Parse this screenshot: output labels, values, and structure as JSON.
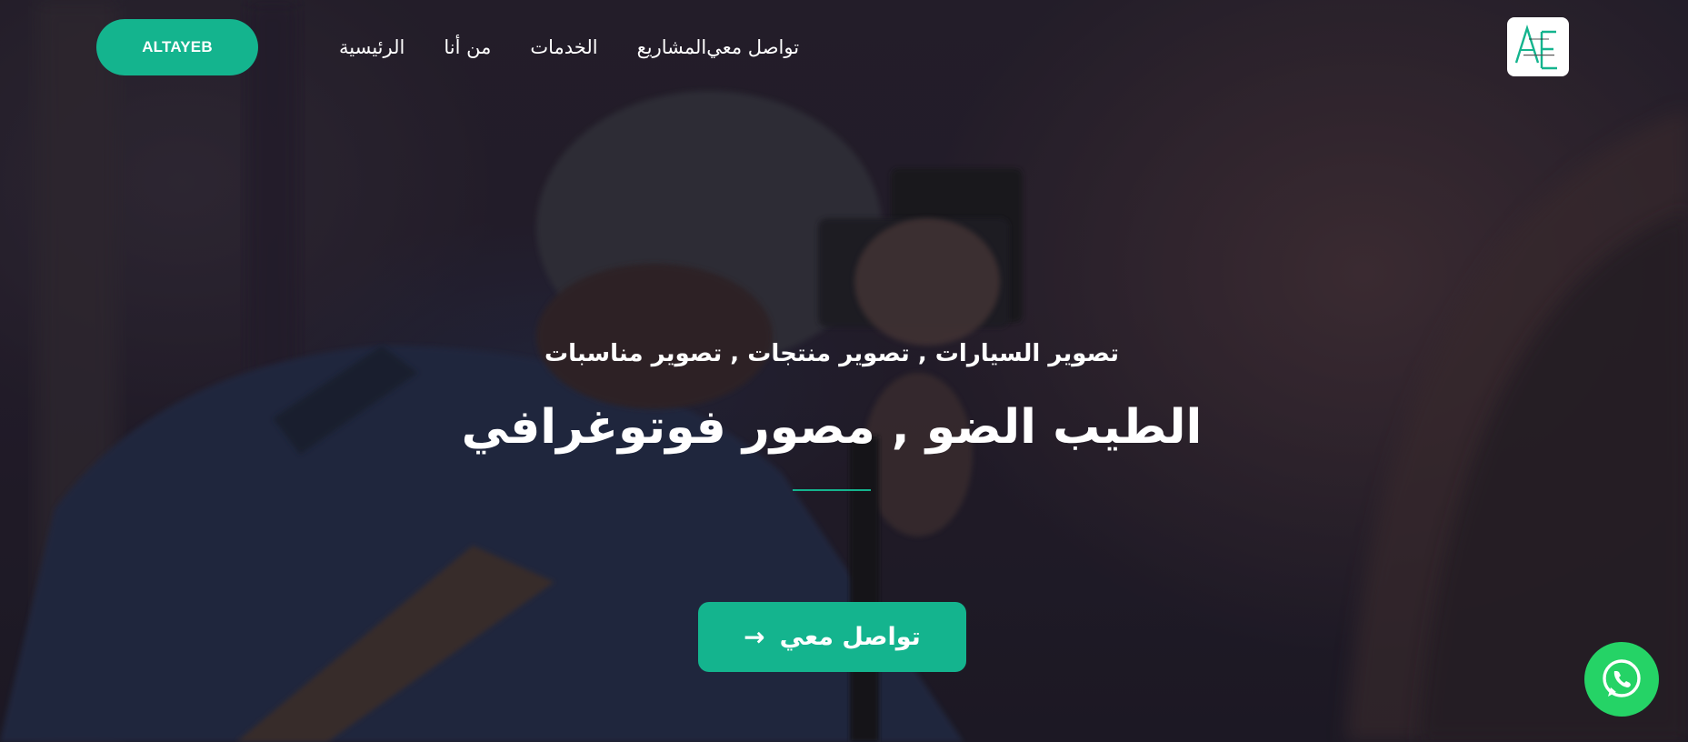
{
  "header": {
    "cta_label": "ALTAYEB",
    "nav": [
      {
        "label": "الرئيسية"
      },
      {
        "label": "من أنا"
      },
      {
        "label": "الخدمات"
      },
      {
        "label": "المشاريع"
      },
      {
        "label": "تواصل معي"
      }
    ],
    "logo_icon": "ae-monogram-logo"
  },
  "hero": {
    "subtitle": "تصوير السيارات , تصوير منتجات , تصوير مناسبات",
    "title": "الطيب الضو , مصور فوتوغرافي",
    "cta_label": "تواصل معي",
    "cta_icon": "arrow-right-icon"
  },
  "floating": {
    "whatsapp_icon": "whatsapp-icon"
  },
  "colors": {
    "accent": "#14b48e",
    "whatsapp": "#25d366",
    "text": "#ffffff"
  }
}
